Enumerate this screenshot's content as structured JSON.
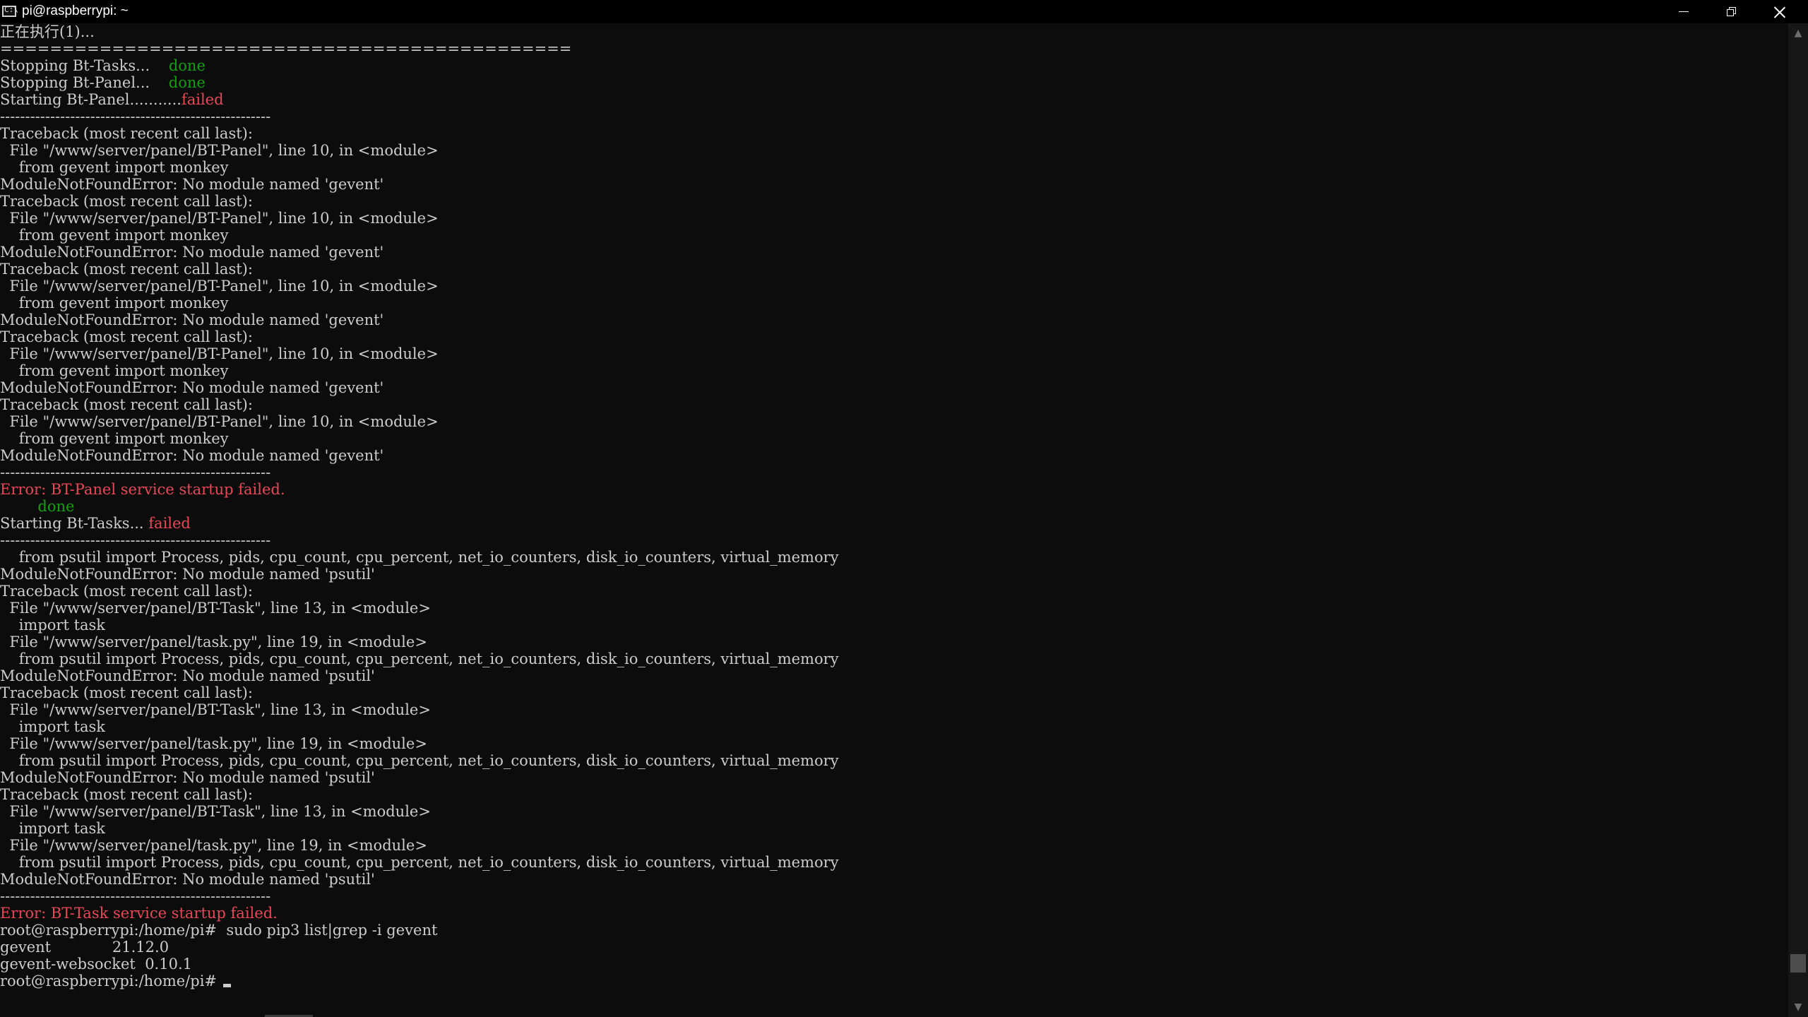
{
  "window": {
    "title": "pi@raspberrypi: ~",
    "icon": "console-app-icon",
    "controls": {
      "minimize": "minimize-icon",
      "maximize": "restore-icon",
      "close": "close-icon"
    }
  },
  "colors": {
    "background": "#0c0c0c",
    "text": "#cccccc",
    "success": "#13a10e",
    "error": "#e74856"
  },
  "terminal": {
    "lines": [
      [
        {
          "t": "正在执行(1)..."
        }
      ],
      [
        {
          "t": "=============================================="
        }
      ],
      [
        {
          "t": "Stopping Bt-Tasks...    "
        },
        {
          "t": "done",
          "c": "green"
        }
      ],
      [
        {
          "t": "Stopping Bt-Panel...    "
        },
        {
          "t": "done",
          "c": "green"
        }
      ],
      [
        {
          "t": "Starting Bt-Panel..........."
        },
        {
          "t": "failed",
          "c": "red"
        }
      ],
      [
        {
          "t": "------------------------------------------------------"
        }
      ],
      [
        {
          "t": "Traceback (most recent call last):"
        }
      ],
      [
        {
          "t": "  File \"/www/server/panel/BT-Panel\", line 10, in <module>"
        }
      ],
      [
        {
          "t": "    from gevent import monkey"
        }
      ],
      [
        {
          "t": "ModuleNotFoundError: No module named 'gevent'"
        }
      ],
      [
        {
          "t": "Traceback (most recent call last):"
        }
      ],
      [
        {
          "t": "  File \"/www/server/panel/BT-Panel\", line 10, in <module>"
        }
      ],
      [
        {
          "t": "    from gevent import monkey"
        }
      ],
      [
        {
          "t": "ModuleNotFoundError: No module named 'gevent'"
        }
      ],
      [
        {
          "t": "Traceback (most recent call last):"
        }
      ],
      [
        {
          "t": "  File \"/www/server/panel/BT-Panel\", line 10, in <module>"
        }
      ],
      [
        {
          "t": "    from gevent import monkey"
        }
      ],
      [
        {
          "t": "ModuleNotFoundError: No module named 'gevent'"
        }
      ],
      [
        {
          "t": "Traceback (most recent call last):"
        }
      ],
      [
        {
          "t": "  File \"/www/server/panel/BT-Panel\", line 10, in <module>"
        }
      ],
      [
        {
          "t": "    from gevent import monkey"
        }
      ],
      [
        {
          "t": "ModuleNotFoundError: No module named 'gevent'"
        }
      ],
      [
        {
          "t": "Traceback (most recent call last):"
        }
      ],
      [
        {
          "t": "  File \"/www/server/panel/BT-Panel\", line 10, in <module>"
        }
      ],
      [
        {
          "t": "    from gevent import monkey"
        }
      ],
      [
        {
          "t": "ModuleNotFoundError: No module named 'gevent'"
        }
      ],
      [
        {
          "t": "------------------------------------------------------"
        }
      ],
      [
        {
          "t": "Error: BT-Panel service startup failed.",
          "c": "red"
        }
      ],
      [
        {
          "t": "        "
        },
        {
          "t": "done",
          "c": "green"
        }
      ],
      [
        {
          "t": "Starting Bt-Tasks... "
        },
        {
          "t": "failed",
          "c": "red"
        }
      ],
      [
        {
          "t": "------------------------------------------------------"
        }
      ],
      [
        {
          "t": "    from psutil import Process, pids, cpu_count, cpu_percent, net_io_counters, disk_io_counters, virtual_memory"
        }
      ],
      [
        {
          "t": "ModuleNotFoundError: No module named 'psutil'"
        }
      ],
      [
        {
          "t": "Traceback (most recent call last):"
        }
      ],
      [
        {
          "t": "  File \"/www/server/panel/BT-Task\", line 13, in <module>"
        }
      ],
      [
        {
          "t": "    import task"
        }
      ],
      [
        {
          "t": "  File \"/www/server/panel/task.py\", line 19, in <module>"
        }
      ],
      [
        {
          "t": "    from psutil import Process, pids, cpu_count, cpu_percent, net_io_counters, disk_io_counters, virtual_memory"
        }
      ],
      [
        {
          "t": "ModuleNotFoundError: No module named 'psutil'"
        }
      ],
      [
        {
          "t": "Traceback (most recent call last):"
        }
      ],
      [
        {
          "t": "  File \"/www/server/panel/BT-Task\", line 13, in <module>"
        }
      ],
      [
        {
          "t": "    import task"
        }
      ],
      [
        {
          "t": "  File \"/www/server/panel/task.py\", line 19, in <module>"
        }
      ],
      [
        {
          "t": "    from psutil import Process, pids, cpu_count, cpu_percent, net_io_counters, disk_io_counters, virtual_memory"
        }
      ],
      [
        {
          "t": "ModuleNotFoundError: No module named 'psutil'"
        }
      ],
      [
        {
          "t": "Traceback (most recent call last):"
        }
      ],
      [
        {
          "t": "  File \"/www/server/panel/BT-Task\", line 13, in <module>"
        }
      ],
      [
        {
          "t": "    import task"
        }
      ],
      [
        {
          "t": "  File \"/www/server/panel/task.py\", line 19, in <module>"
        }
      ],
      [
        {
          "t": "    from psutil import Process, pids, cpu_count, cpu_percent, net_io_counters, disk_io_counters, virtual_memory"
        }
      ],
      [
        {
          "t": "ModuleNotFoundError: No module named 'psutil'"
        }
      ],
      [
        {
          "t": "------------------------------------------------------"
        }
      ],
      [
        {
          "t": "Error: BT-Task service startup failed.",
          "c": "red"
        }
      ],
      [
        {
          "t": "root@raspberrypi:/home/pi#  sudo pip3 list|grep -i gevent"
        }
      ],
      [
        {
          "t": "gevent             21.12.0"
        }
      ],
      [
        {
          "t": "gevent-websocket  0.10.1"
        }
      ],
      [
        {
          "t": "root@raspberrypi:/home/pi# "
        }
      ]
    ]
  },
  "scrollbar": {
    "up_icon": "scroll-up-arrow-icon",
    "down_icon": "scroll-down-arrow-icon"
  }
}
